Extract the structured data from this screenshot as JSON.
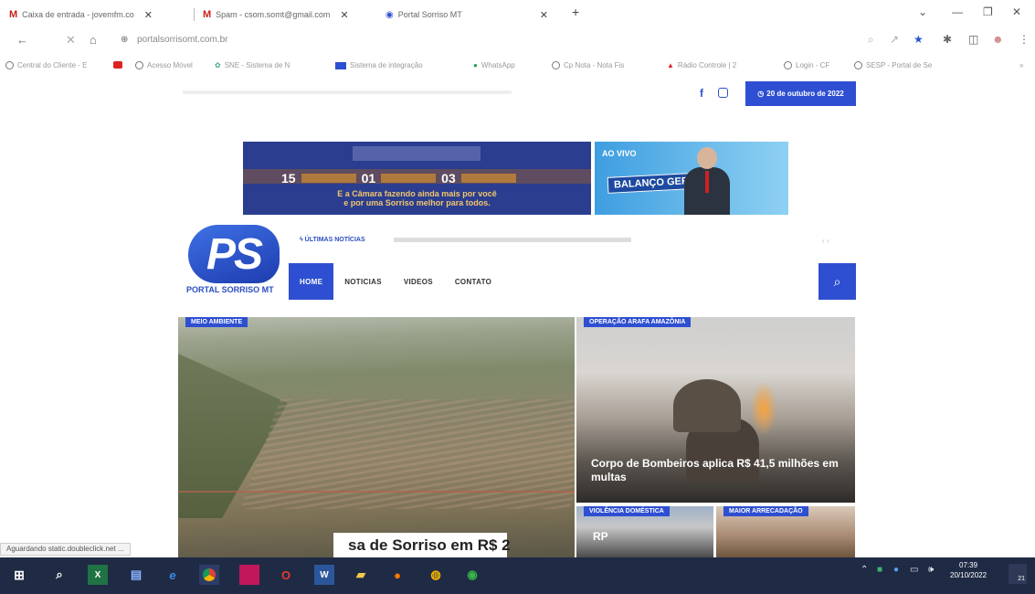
{
  "browser": {
    "tabs": [
      {
        "label": "Caixa de entrada - jovemfm.co",
        "icon": "gmail-icon"
      },
      {
        "label": "Spam - csom.somt@gmail.com",
        "icon": "gmail-icon"
      },
      {
        "label": "Portal Sorriso MT",
        "icon": "site-icon"
      }
    ],
    "new_tab": "+",
    "url": "portalsorrisomt.com.br",
    "bookmarks": [
      "Central do Cliente - E",
      "",
      "Acesso Móvel",
      "SNE - Sistema de N",
      "Sistema de integração",
      "WhatsApp",
      "Cp Nota - Nota Fis",
      "Rádio Controle | 2",
      "Login - CF",
      "SESP - Portal de Se"
    ],
    "status_text": "Aguardando static.doubleclick.net ..."
  },
  "site": {
    "date": "20 de outubro de 2022",
    "banner1": {
      "numbers": [
        "15",
        "01",
        "03"
      ],
      "text_line1": "E a Câmara fazendo ainda mais por você",
      "text_line2": "e por uma Sorriso melhor para todos."
    },
    "banner2": {
      "live": "AO VIVO",
      "show": "BALANÇO GERAL"
    },
    "logo": {
      "mark": "PS",
      "name": "PORTAL SORRISO MT"
    },
    "ticker_label": "ÚLTIMAS NOTÍCIAS",
    "nav": [
      "HOME",
      "NOTICIAS",
      "VIDEOS",
      "CONTATO"
    ],
    "cards": [
      {
        "tag": "MEIO AMBIENTE",
        "headline_visible": "sa de Sorriso em R$ 2"
      },
      {
        "tag": "OPERAÇÃO ARAFA AMAZÔNIA",
        "headline": "Corpo de Bombeiros aplica R$ 41,5 milhões em multas"
      },
      {
        "tag": "VIOLÊNCIA DOMÉSTICA",
        "image_text": "RP"
      },
      {
        "tag": "MAIOR ARRECADAÇÃO"
      }
    ]
  },
  "taskbar": {
    "time": "07:39",
    "date": "20/10/2022",
    "notifications": "21"
  }
}
